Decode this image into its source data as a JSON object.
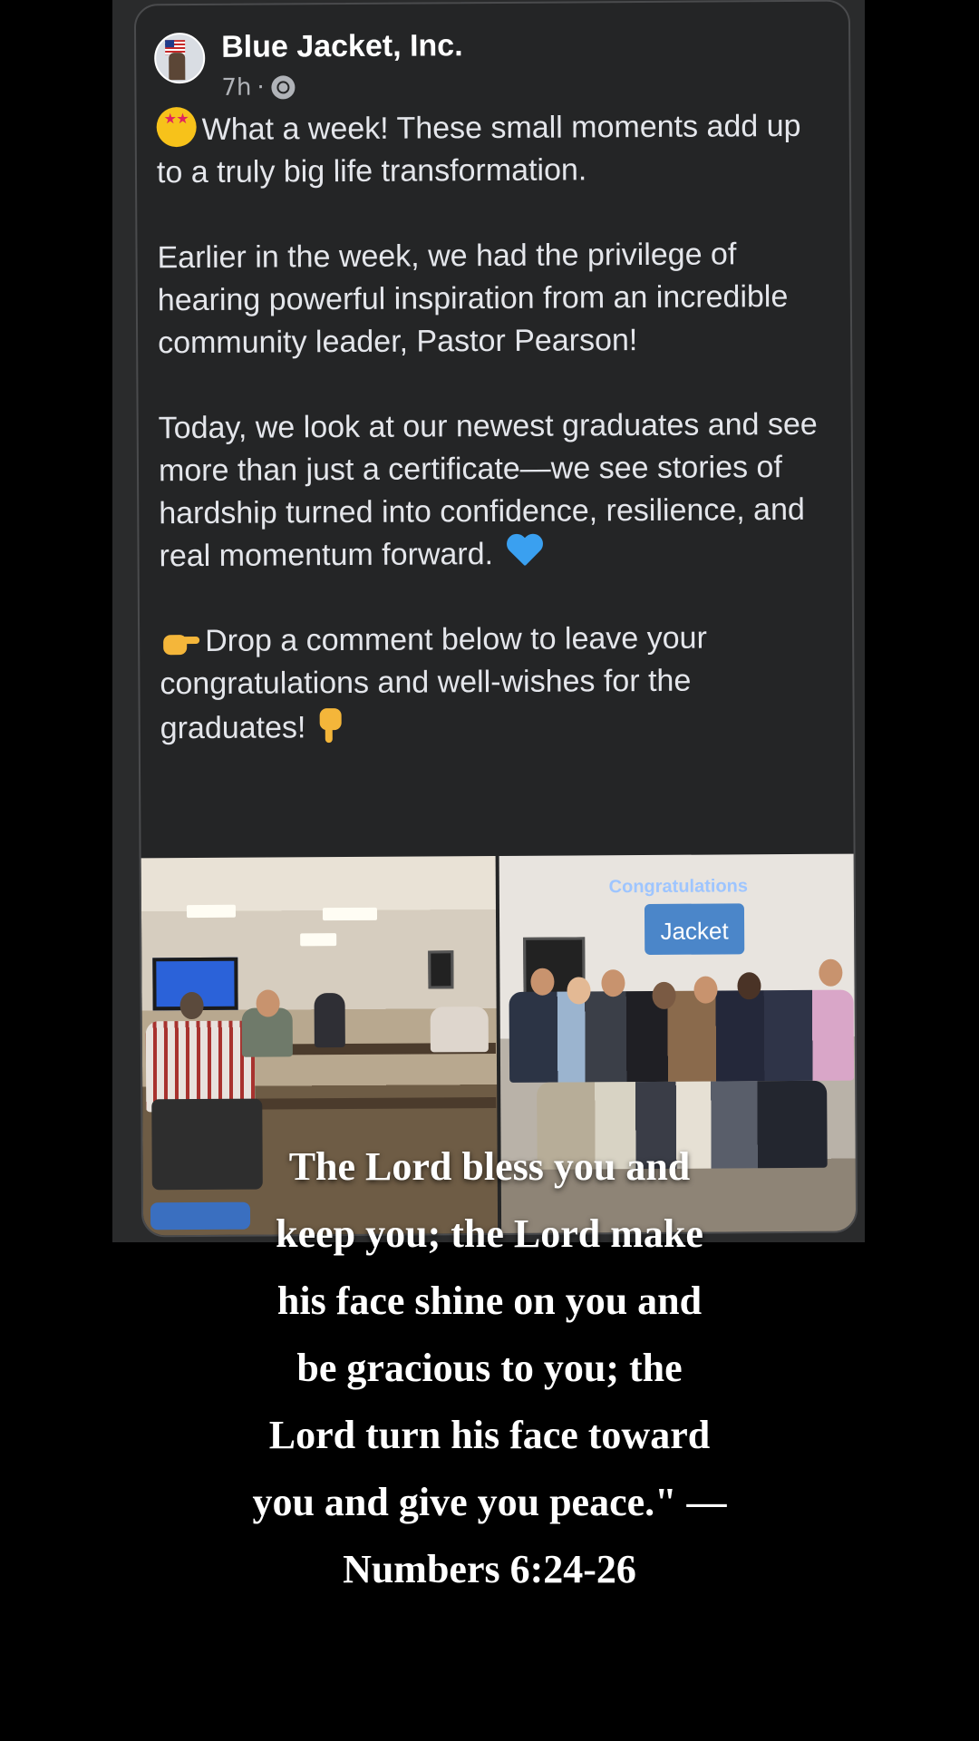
{
  "post": {
    "page_name": "Blue Jacket, Inc.",
    "time": "7h",
    "separator": "·",
    "privacy_icon": "globe-icon",
    "paragraphs": {
      "p1": "What a week! These small moments add up to a truly big life transformation.",
      "p2": "Earlier in the week, we had the privilege of hearing powerful inspiration from an incredible community leader, Pastor Pearson!",
      "p3": "Today, we look at our newest graduates and see more than just a certificate—we see stories of hardship turned into confidence, resilience, and real momentum forward.",
      "p4": "Drop a comment below to leave your congratulations and well-wishes for the graduates!"
    },
    "photos": {
      "right_banner": "Congratulations",
      "logo_text": "Jacket"
    }
  },
  "overlay": {
    "verse_lines": [
      "The Lord bless you and",
      "keep you; the Lord make",
      "his face shine on you and",
      "be gracious to you; the",
      "Lord turn his face toward",
      "you and give you peace.\" —",
      "Numbers 6:24-26"
    ]
  },
  "colors": {
    "card_bg": "#242526",
    "text": "#e4e6eb",
    "meta": "#b0b3b8",
    "background": "#000000"
  }
}
